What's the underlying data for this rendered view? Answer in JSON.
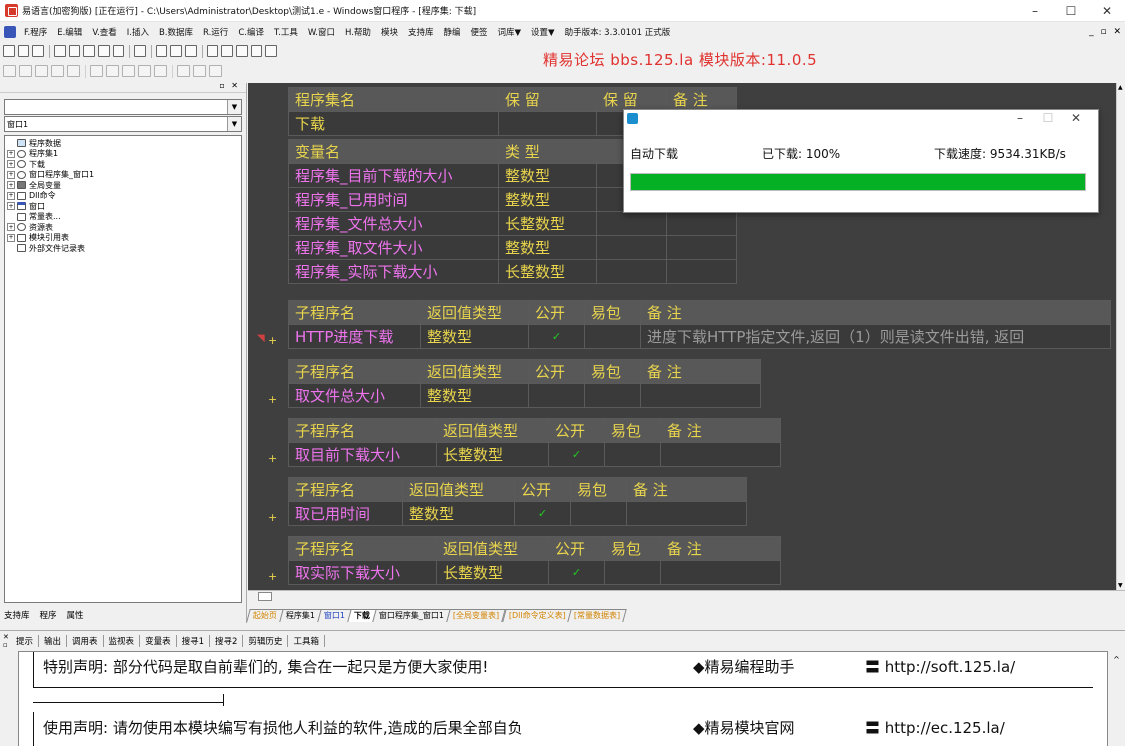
{
  "window": {
    "title": "易语言(加密狗版) [正在运行] - C:\\Users\\Administrator\\Desktop\\测试1.e - Windows窗口程序 - [程序集: 下载]",
    "controls": [
      "–",
      "☐",
      "✕"
    ]
  },
  "menu": {
    "items": [
      "F.程序",
      "E.编辑",
      "V.查看",
      "I.插入",
      "B.数据库",
      "R.运行",
      "C.编译",
      "T.工具",
      "W.窗口",
      "H.帮助",
      "模块",
      "支持库",
      "静编",
      "便签",
      "词库▼",
      "设置▼",
      "助手版本: 3.3.0101 正式版"
    ],
    "mdi_controls": "_ ▫ ✕"
  },
  "banner": "精易论坛 bbs.125.la 模块版本:11.0.5",
  "left_panel": {
    "combo1": "",
    "combo2": "窗口1",
    "tree": [
      {
        "label": "程序数据",
        "level": 0,
        "exp": ""
      },
      {
        "label": "程序集1",
        "level": 0,
        "exp": "+"
      },
      {
        "label": "下载",
        "level": 0,
        "exp": "+"
      },
      {
        "label": "窗口程序集_窗口1",
        "level": 0,
        "exp": "+"
      },
      {
        "label": "全局变量",
        "level": 0,
        "exp": "+"
      },
      {
        "label": "Dll命令",
        "level": 0,
        "exp": "+"
      },
      {
        "label": "窗口",
        "level": 0,
        "exp": "+"
      },
      {
        "label": "常量表...",
        "level": 0,
        "exp": ""
      },
      {
        "label": "资源表",
        "level": 0,
        "exp": "+"
      },
      {
        "label": "模块引用表",
        "level": 0,
        "exp": "+"
      },
      {
        "label": "外部文件记录表",
        "level": 0,
        "exp": ""
      }
    ],
    "tabs": [
      "支持库",
      "程序",
      "属性"
    ]
  },
  "editor": {
    "assembly": {
      "headers": [
        "程序集名",
        "保 留",
        "保 留",
        "备 注"
      ],
      "name": "下载"
    },
    "variables": {
      "headers": [
        "变量名",
        "类 型"
      ],
      "rows": [
        [
          "程序集_目前下载的大小",
          "整数型"
        ],
        [
          "程序集_已用时间",
          "整数型"
        ],
        [
          "程序集_文件总大小",
          "长整数型"
        ],
        [
          "程序集_取文件大小",
          "整数型"
        ],
        [
          "程序集_实际下载大小",
          "长整数型"
        ]
      ]
    },
    "subs": [
      {
        "headers": [
          "子程序名",
          "返回值类型",
          "公开",
          "易包",
          "备 注"
        ],
        "name": "HTTP进度下载",
        "ret": "整数型",
        "public": "✓",
        "note": "进度下载HTTP指定文件,返回（1）则是读文件出错, 返回"
      },
      {
        "headers": [
          "子程序名",
          "返回值类型",
          "公开",
          "易包",
          "备 注"
        ],
        "name": "取文件总大小",
        "ret": "整数型",
        "public": "",
        "note": ""
      },
      {
        "headers": [
          "子程序名",
          "返回值类型",
          "公开",
          "易包",
          "备 注"
        ],
        "name": "取目前下载大小",
        "ret": "长整数型",
        "public": "✓",
        "note": ""
      },
      {
        "headers": [
          "子程序名",
          "返回值类型",
          "公开",
          "易包",
          "备 注"
        ],
        "name": "取已用时间",
        "ret": "整数型",
        "public": "✓",
        "note": ""
      },
      {
        "headers": [
          "子程序名",
          "返回值类型",
          "公开",
          "易包",
          "备 注"
        ],
        "name": "取实际下载大小",
        "ret": "长整数型",
        "public": "✓",
        "note": ""
      }
    ]
  },
  "dialog": {
    "label_auto": "自动下载",
    "downloaded": "已下载: 100%",
    "speed": "下载速度: 9534.31KB/s",
    "progress": 1.0,
    "controls": [
      "–",
      "☐",
      "✕"
    ]
  },
  "bottom_tabs": [
    "起始页",
    "程序集1",
    "窗口1",
    "下载",
    "窗口程序集_窗口1",
    "[全局变量表]",
    "[Dll命令定义表]",
    "[常量数据表]"
  ],
  "output": {
    "tabs": [
      "提示",
      "输出",
      "调用表",
      "监视表",
      "变量表",
      "搜寻1",
      "搜寻2",
      "剪辑历史",
      "工具箱"
    ],
    "line1_left": "特别声明: 部分代码是取自前辈们的, 集合在一起只是方便大家使用!",
    "line1_mid": "◆精易编程助手",
    "line1_right": "〓 http://soft.125.la/",
    "line2_left": "使用声明: 请勿使用本模块编写有损他人利益的软件,造成的后果全部自负",
    "line2_mid": "◆精易模块官网",
    "line2_right": "〓 http://ec.125.la/"
  },
  "colors": {
    "editor_bg": "#3f3f3f",
    "header_text": "#e8d44d",
    "name_text": "#ee74ee",
    "progress": "#06b025",
    "banner": "#e0322e"
  }
}
